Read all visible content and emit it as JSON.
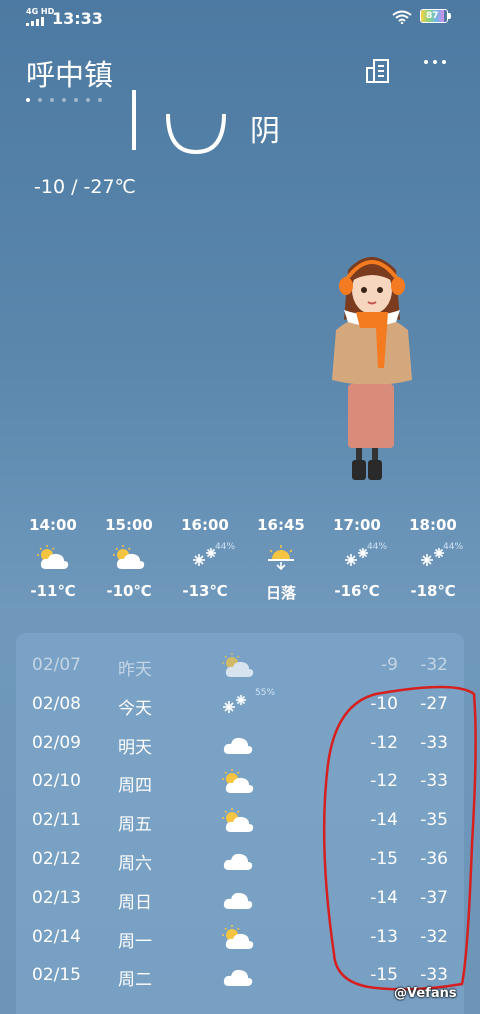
{
  "status": {
    "network": "4G HD",
    "time": "13:33",
    "battery": "87"
  },
  "header": {
    "city": "呼中镇",
    "page_count": 7,
    "active_page": 0
  },
  "current": {
    "condition": "阴",
    "range": "-10  /  -27℃"
  },
  "hourly": [
    {
      "time": "14:00",
      "icon": "partly-cloudy-icon",
      "pct": "",
      "value": "-11℃"
    },
    {
      "time": "15:00",
      "icon": "partly-cloudy-icon",
      "pct": "",
      "value": "-10℃"
    },
    {
      "time": "16:00",
      "icon": "snow-icon",
      "pct": "44%",
      "value": "-13℃"
    },
    {
      "time": "16:45",
      "icon": "sunset-icon",
      "pct": "",
      "value": "日落"
    },
    {
      "time": "17:00",
      "icon": "snow-icon",
      "pct": "44%",
      "value": "-16℃"
    },
    {
      "time": "18:00",
      "icon": "snow-icon",
      "pct": "44%",
      "value": "-18℃"
    }
  ],
  "daily": [
    {
      "date": "02/07",
      "day": "昨天",
      "icon": "partly-cloudy-icon",
      "pct": "",
      "low": "-9",
      "high": "-32",
      "past": true
    },
    {
      "date": "02/08",
      "day": "今天",
      "icon": "snow-icon",
      "pct": "55%",
      "low": "-10",
      "high": "-27",
      "past": false
    },
    {
      "date": "02/09",
      "day": "明天",
      "icon": "cloud-icon",
      "pct": "",
      "low": "-12",
      "high": "-33",
      "past": false
    },
    {
      "date": "02/10",
      "day": "周四",
      "icon": "partly-cloudy-icon",
      "pct": "",
      "low": "-12",
      "high": "-33",
      "past": false
    },
    {
      "date": "02/11",
      "day": "周五",
      "icon": "partly-cloudy-icon",
      "pct": "",
      "low": "-14",
      "high": "-35",
      "past": false
    },
    {
      "date": "02/12",
      "day": "周六",
      "icon": "cloud-icon",
      "pct": "",
      "low": "-15",
      "high": "-36",
      "past": false
    },
    {
      "date": "02/13",
      "day": "周日",
      "icon": "cloud-icon",
      "pct": "",
      "low": "-14",
      "high": "-37",
      "past": false
    },
    {
      "date": "02/14",
      "day": "周一",
      "icon": "partly-cloudy-icon",
      "pct": "",
      "low": "-13",
      "high": "-32",
      "past": false
    },
    {
      "date": "02/15",
      "day": "周二",
      "icon": "cloud-icon",
      "pct": "",
      "low": "-15",
      "high": "-33",
      "past": false
    }
  ],
  "watermark": "@Vefans",
  "colors": {
    "sun": "#f5c542",
    "annotation": "#d6201f",
    "scarf": "#f47b20"
  }
}
